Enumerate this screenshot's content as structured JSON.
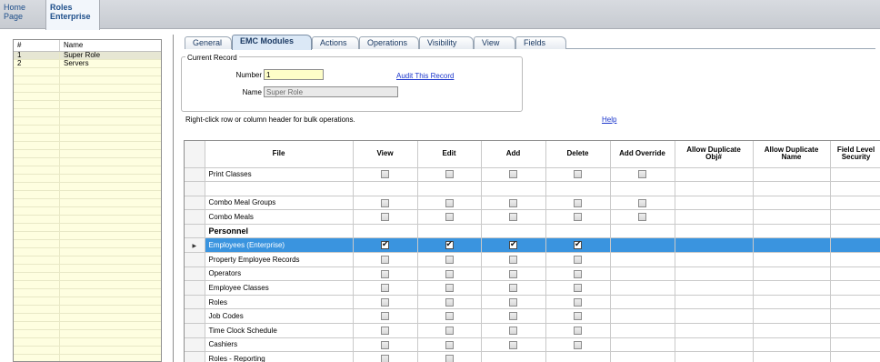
{
  "top_tabs": [
    {
      "label_line1": "Home",
      "label_line2": "Page"
    },
    {
      "label_line1": "Roles",
      "label_line2": "Enterprise"
    }
  ],
  "roles_list": {
    "columns": [
      "#",
      "Name"
    ],
    "rows": [
      {
        "num": "1",
        "name": "Super Role"
      },
      {
        "num": "2",
        "name": "Servers"
      }
    ]
  },
  "tabs": [
    "General",
    "EMC Modules",
    "Actions",
    "Operations",
    "Visibility",
    "View",
    "Fields"
  ],
  "active_tab": "EMC Modules",
  "current_record": {
    "title": "Current Record",
    "number_label": "Number",
    "number_value": "1",
    "name_label": "Name",
    "name_value": "Super Role",
    "audit_link": "Audit This Record"
  },
  "hint_text": "Right-click row or column header for bulk operations.",
  "help_link": "Help",
  "grid": {
    "columns": [
      "File",
      "View",
      "Edit",
      "Add",
      "Delete",
      "Add Override",
      "Allow Duplicate Obj#",
      "Allow Duplicate Name",
      "Field Level Security"
    ],
    "rows": [
      {
        "file": "Print Classes",
        "type": "item",
        "checks": [
          0,
          0,
          0,
          0,
          0
        ]
      },
      {
        "file": "",
        "type": "blank",
        "checks": []
      },
      {
        "file": "Combo Meal Groups",
        "type": "item",
        "checks": [
          0,
          0,
          0,
          0,
          0
        ]
      },
      {
        "file": "Combo Meals",
        "type": "item",
        "checks": [
          0,
          0,
          0,
          0,
          0
        ]
      },
      {
        "file": "Personnel",
        "type": "section",
        "checks": []
      },
      {
        "file": "Employees (Enterprise)",
        "type": "selected",
        "checks": [
          1,
          1,
          1,
          1
        ]
      },
      {
        "file": "Property Employee Records",
        "type": "item",
        "checks": [
          0,
          0,
          0,
          0
        ]
      },
      {
        "file": "Operators",
        "type": "item",
        "checks": [
          0,
          0,
          0,
          0
        ]
      },
      {
        "file": "Employee Classes",
        "type": "item",
        "checks": [
          0,
          0,
          0,
          0
        ]
      },
      {
        "file": "Roles",
        "type": "item",
        "checks": [
          0,
          0,
          0,
          0
        ]
      },
      {
        "file": "Job Codes",
        "type": "item",
        "checks": [
          0,
          0,
          0,
          0
        ]
      },
      {
        "file": "Time Clock Schedule",
        "type": "item",
        "checks": [
          0,
          0,
          0,
          0
        ]
      },
      {
        "file": "Cashiers",
        "type": "item",
        "checks": [
          0,
          0,
          0,
          0
        ]
      },
      {
        "file": "Roles - Reporting",
        "type": "item",
        "checks": [
          0,
          0
        ]
      }
    ]
  },
  "colors": {
    "selection": "#3a94df",
    "link": "#1a35cc",
    "list_bg": "#fefee0",
    "number_bg": "#fefec8"
  }
}
